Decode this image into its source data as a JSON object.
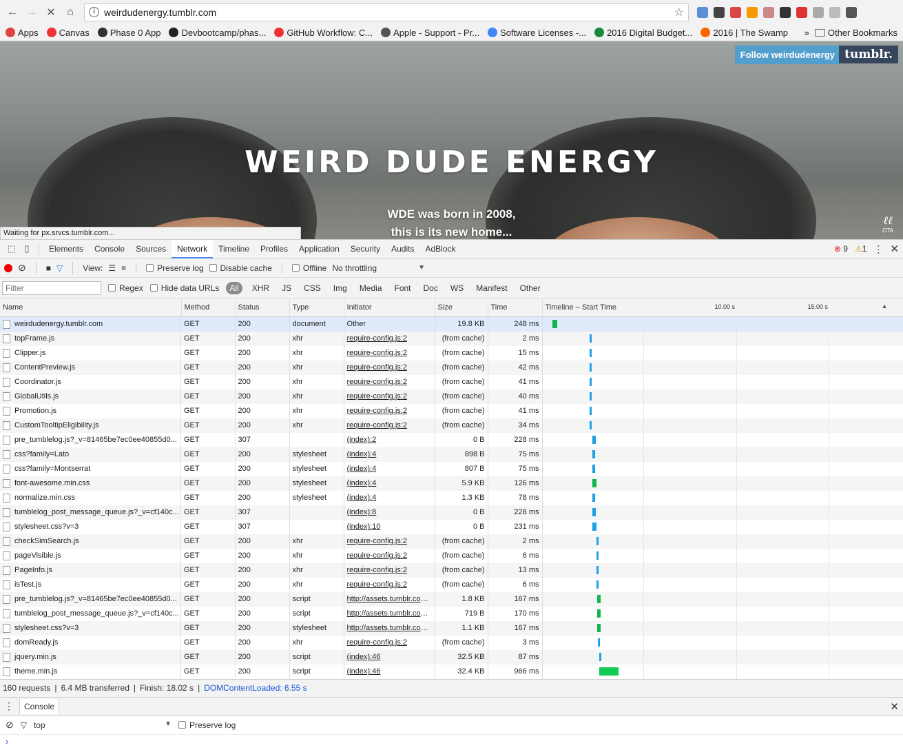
{
  "browser": {
    "url": "weirdudenergy.tumblr.com",
    "extensions": [
      "#5b8fd8",
      "#444",
      "#d44",
      "#f59b00",
      "#c88",
      "#333",
      "#d33",
      "#aaa",
      "#bbb",
      "#555"
    ],
    "bookmarks": [
      {
        "label": "Apps",
        "color": "#d44"
      },
      {
        "label": "Canvas",
        "color": "#e33"
      },
      {
        "label": "Phase 0 App",
        "color": "#333"
      },
      {
        "label": "Devbootcamp/phas...",
        "color": "#222"
      },
      {
        "label": "GitHub Workflow: C...",
        "color": "#e33"
      },
      {
        "label": "Apple - Support - Pr...",
        "color": "#555"
      },
      {
        "label": "Software Licenses -...",
        "color": "#4285f4"
      },
      {
        "label": "2016 Digital Budget...",
        "color": "#1a8a3a"
      },
      {
        "label": "2016 | The Swamp",
        "color": "#f60"
      }
    ],
    "other_bookmarks": "Other Bookmarks",
    "more": "»"
  },
  "page": {
    "title": "WEIRD DUDE ENERGY",
    "desc_line1": "WDE was born in 2008,",
    "desc_line2": "this is its new home...",
    "follow": "Follow weirdudenergy",
    "logo": "tumblr.",
    "ota": "OTA",
    "status": "Waiting for px.srvcs.tumblr.com..."
  },
  "devtools": {
    "tabs": [
      "Elements",
      "Console",
      "Sources",
      "Network",
      "Timeline",
      "Profiles",
      "Application",
      "Security",
      "Audits",
      "AdBlock"
    ],
    "active_tab": "Network",
    "errors": "9",
    "warnings": "1",
    "toolbar": {
      "view_label": "View:",
      "preserve_log": "Preserve log",
      "disable_cache": "Disable cache",
      "offline": "Offline",
      "throttling": "No throttling"
    },
    "filter": {
      "placeholder": "Filter",
      "regex": "Regex",
      "hide_data_urls": "Hide data URLs",
      "types": [
        "All",
        "XHR",
        "JS",
        "CSS",
        "Img",
        "Media",
        "Font",
        "Doc",
        "WS",
        "Manifest",
        "Other"
      ]
    },
    "columns": [
      "Name",
      "Method",
      "Status",
      "Type",
      "Initiator",
      "Size",
      "Time",
      "Timeline – Start Time"
    ],
    "timeline_ticks": [
      "10.00 s",
      "15.00 s"
    ],
    "rows": [
      {
        "name": "weirdudenergy.tumblr.com",
        "method": "GET",
        "status": "200",
        "type": "document",
        "initiator": "Other",
        "size": "19.8 KB",
        "time": "248 ms",
        "start": 0.1,
        "dur": 0.25,
        "color": "#12b54e",
        "sel": true,
        "link": false,
        "cache": false
      },
      {
        "name": "topFrame.js",
        "method": "GET",
        "status": "200",
        "type": "xhr",
        "initiator": "require-config.js:2",
        "size": "(from cache)",
        "time": "2 ms",
        "start": 2.1,
        "dur": 0.05,
        "color": "#1ea1e6",
        "link": true,
        "cache": true
      },
      {
        "name": "Clipper.js",
        "method": "GET",
        "status": "200",
        "type": "xhr",
        "initiator": "require-config.js:2",
        "size": "(from cache)",
        "time": "15 ms",
        "start": 2.1,
        "dur": 0.05,
        "color": "#1ea1e6",
        "link": true,
        "cache": true
      },
      {
        "name": "ContentPreview.js",
        "method": "GET",
        "status": "200",
        "type": "xhr",
        "initiator": "require-config.js:2",
        "size": "(from cache)",
        "time": "42 ms",
        "start": 2.1,
        "dur": 0.05,
        "color": "#1ea1e6",
        "link": true,
        "cache": true
      },
      {
        "name": "Coordinator.js",
        "method": "GET",
        "status": "200",
        "type": "xhr",
        "initiator": "require-config.js:2",
        "size": "(from cache)",
        "time": "41 ms",
        "start": 2.1,
        "dur": 0.05,
        "color": "#1ea1e6",
        "link": true,
        "cache": true
      },
      {
        "name": "GlobalUtils.js",
        "method": "GET",
        "status": "200",
        "type": "xhr",
        "initiator": "require-config.js:2",
        "size": "(from cache)",
        "time": "40 ms",
        "start": 2.1,
        "dur": 0.05,
        "color": "#1ea1e6",
        "link": true,
        "cache": true
      },
      {
        "name": "Promotion.js",
        "method": "GET",
        "status": "200",
        "type": "xhr",
        "initiator": "require-config.js:2",
        "size": "(from cache)",
        "time": "41 ms",
        "start": 2.1,
        "dur": 0.05,
        "color": "#1ea1e6",
        "link": true,
        "cache": true
      },
      {
        "name": "CustomTooltipEligibility.js",
        "method": "GET",
        "status": "200",
        "type": "xhr",
        "initiator": "require-config.js:2",
        "size": "(from cache)",
        "time": "34 ms",
        "start": 2.1,
        "dur": 0.05,
        "color": "#1ea1e6",
        "link": true,
        "cache": true
      },
      {
        "name": "pre_tumblelog.js?_v=81465be7ec0ee40855d0...",
        "method": "GET",
        "status": "307",
        "type": "",
        "initiator": "(index):2",
        "size": "0 B",
        "time": "228 ms",
        "start": 2.25,
        "dur": 0.16,
        "color": "#1ea1e6",
        "link": true,
        "cache": false
      },
      {
        "name": "css?family=Lato",
        "method": "GET",
        "status": "200",
        "type": "stylesheet",
        "initiator": "(index):4",
        "size": "898 B",
        "time": "75 ms",
        "start": 2.25,
        "dur": 0.13,
        "color": "#1ea1e6",
        "link": true,
        "cache": false
      },
      {
        "name": "css?family=Montserrat",
        "method": "GET",
        "status": "200",
        "type": "stylesheet",
        "initiator": "(index):4",
        "size": "807 B",
        "time": "75 ms",
        "start": 2.25,
        "dur": 0.13,
        "color": "#1ea1e6",
        "link": true,
        "cache": false
      },
      {
        "name": "font-awesome.min.css",
        "method": "GET",
        "status": "200",
        "type": "stylesheet",
        "initiator": "(index):4",
        "size": "5.9 KB",
        "time": "126 ms",
        "start": 2.25,
        "dur": 0.2,
        "color": "#12b54e",
        "link": true,
        "cache": false
      },
      {
        "name": "normalize.min.css",
        "method": "GET",
        "status": "200",
        "type": "stylesheet",
        "initiator": "(index):4",
        "size": "1.3 KB",
        "time": "78 ms",
        "start": 2.25,
        "dur": 0.13,
        "color": "#1ea1e6",
        "link": true,
        "cache": false
      },
      {
        "name": "tumblelog_post_message_queue.js?_v=cf140c...",
        "method": "GET",
        "status": "307",
        "type": "",
        "initiator": "(index):8",
        "size": "0 B",
        "time": "228 ms",
        "start": 2.25,
        "dur": 0.16,
        "color": "#1ea1e6",
        "link": true,
        "cache": false
      },
      {
        "name": "stylesheet.css?v=3",
        "method": "GET",
        "status": "307",
        "type": "",
        "initiator": "(index):10",
        "size": "0 B",
        "time": "231 ms",
        "start": 2.25,
        "dur": 0.2,
        "color": "#1ea1e6",
        "link": true,
        "cache": false
      },
      {
        "name": "checkSimSearch.js",
        "method": "GET",
        "status": "200",
        "type": "xhr",
        "initiator": "require-config.js:2",
        "size": "(from cache)",
        "time": "2 ms",
        "start": 2.45,
        "dur": 0.05,
        "color": "#1ea1e6",
        "link": true,
        "cache": true
      },
      {
        "name": "pageVisible.js",
        "method": "GET",
        "status": "200",
        "type": "xhr",
        "initiator": "require-config.js:2",
        "size": "(from cache)",
        "time": "6 ms",
        "start": 2.45,
        "dur": 0.05,
        "color": "#1ea1e6",
        "link": true,
        "cache": true
      },
      {
        "name": "PageInfo.js",
        "method": "GET",
        "status": "200",
        "type": "xhr",
        "initiator": "require-config.js:2",
        "size": "(from cache)",
        "time": "13 ms",
        "start": 2.45,
        "dur": 0.05,
        "color": "#1ea1e6",
        "link": true,
        "cache": true
      },
      {
        "name": "isTest.js",
        "method": "GET",
        "status": "200",
        "type": "xhr",
        "initiator": "require-config.js:2",
        "size": "(from cache)",
        "time": "6 ms",
        "start": 2.45,
        "dur": 0.05,
        "color": "#1ea1e6",
        "link": true,
        "cache": true
      },
      {
        "name": "pre_tumblelog.js?_v=81465be7ec0ee40855d0...",
        "method": "GET",
        "status": "200",
        "type": "script",
        "initiator": "http://assets.tumblr.com...",
        "size": "1.8 KB",
        "time": "167 ms",
        "start": 2.5,
        "dur": 0.2,
        "color": "#12b54e",
        "link": true,
        "cache": false
      },
      {
        "name": "tumblelog_post_message_queue.js?_v=cf140c...",
        "method": "GET",
        "status": "200",
        "type": "script",
        "initiator": "http://assets.tumblr.com...",
        "size": "719 B",
        "time": "170 ms",
        "start": 2.5,
        "dur": 0.2,
        "color": "#12b54e",
        "link": true,
        "cache": false
      },
      {
        "name": "stylesheet.css?v=3",
        "method": "GET",
        "status": "200",
        "type": "stylesheet",
        "initiator": "http://assets.tumblr.com...",
        "size": "1.1 KB",
        "time": "167 ms",
        "start": 2.5,
        "dur": 0.2,
        "color": "#12b54e",
        "link": true,
        "cache": false
      },
      {
        "name": "domReady.js",
        "method": "GET",
        "status": "200",
        "type": "xhr",
        "initiator": "require-config.js:2",
        "size": "(from cache)",
        "time": "3 ms",
        "start": 2.55,
        "dur": 0.05,
        "color": "#1ea1e6",
        "link": true,
        "cache": true
      },
      {
        "name": "jquery.min.js",
        "method": "GET",
        "status": "200",
        "type": "script",
        "initiator": "(index):46",
        "size": "32.5 KB",
        "time": "87 ms",
        "start": 2.6,
        "dur": 0.13,
        "color": "#1ea1e6",
        "link": true,
        "cache": false
      },
      {
        "name": "theme.min.js",
        "method": "GET",
        "status": "200",
        "type": "script",
        "initiator": "(index):46",
        "size": "32.4 KB",
        "time": "966 ms",
        "start": 2.6,
        "dur": 1.05,
        "color": "#12cc55",
        "link": true,
        "cache": false
      }
    ],
    "summary": {
      "requests": "160 requests",
      "transferred": "6.4 MB transferred",
      "finish": "Finish: 18.02 s",
      "dcl": "DOMContentLoaded: 6.55 s"
    }
  },
  "console_drawer": {
    "tab": "Console",
    "context": "top",
    "preserve_log": "Preserve log",
    "prompt": "›"
  }
}
